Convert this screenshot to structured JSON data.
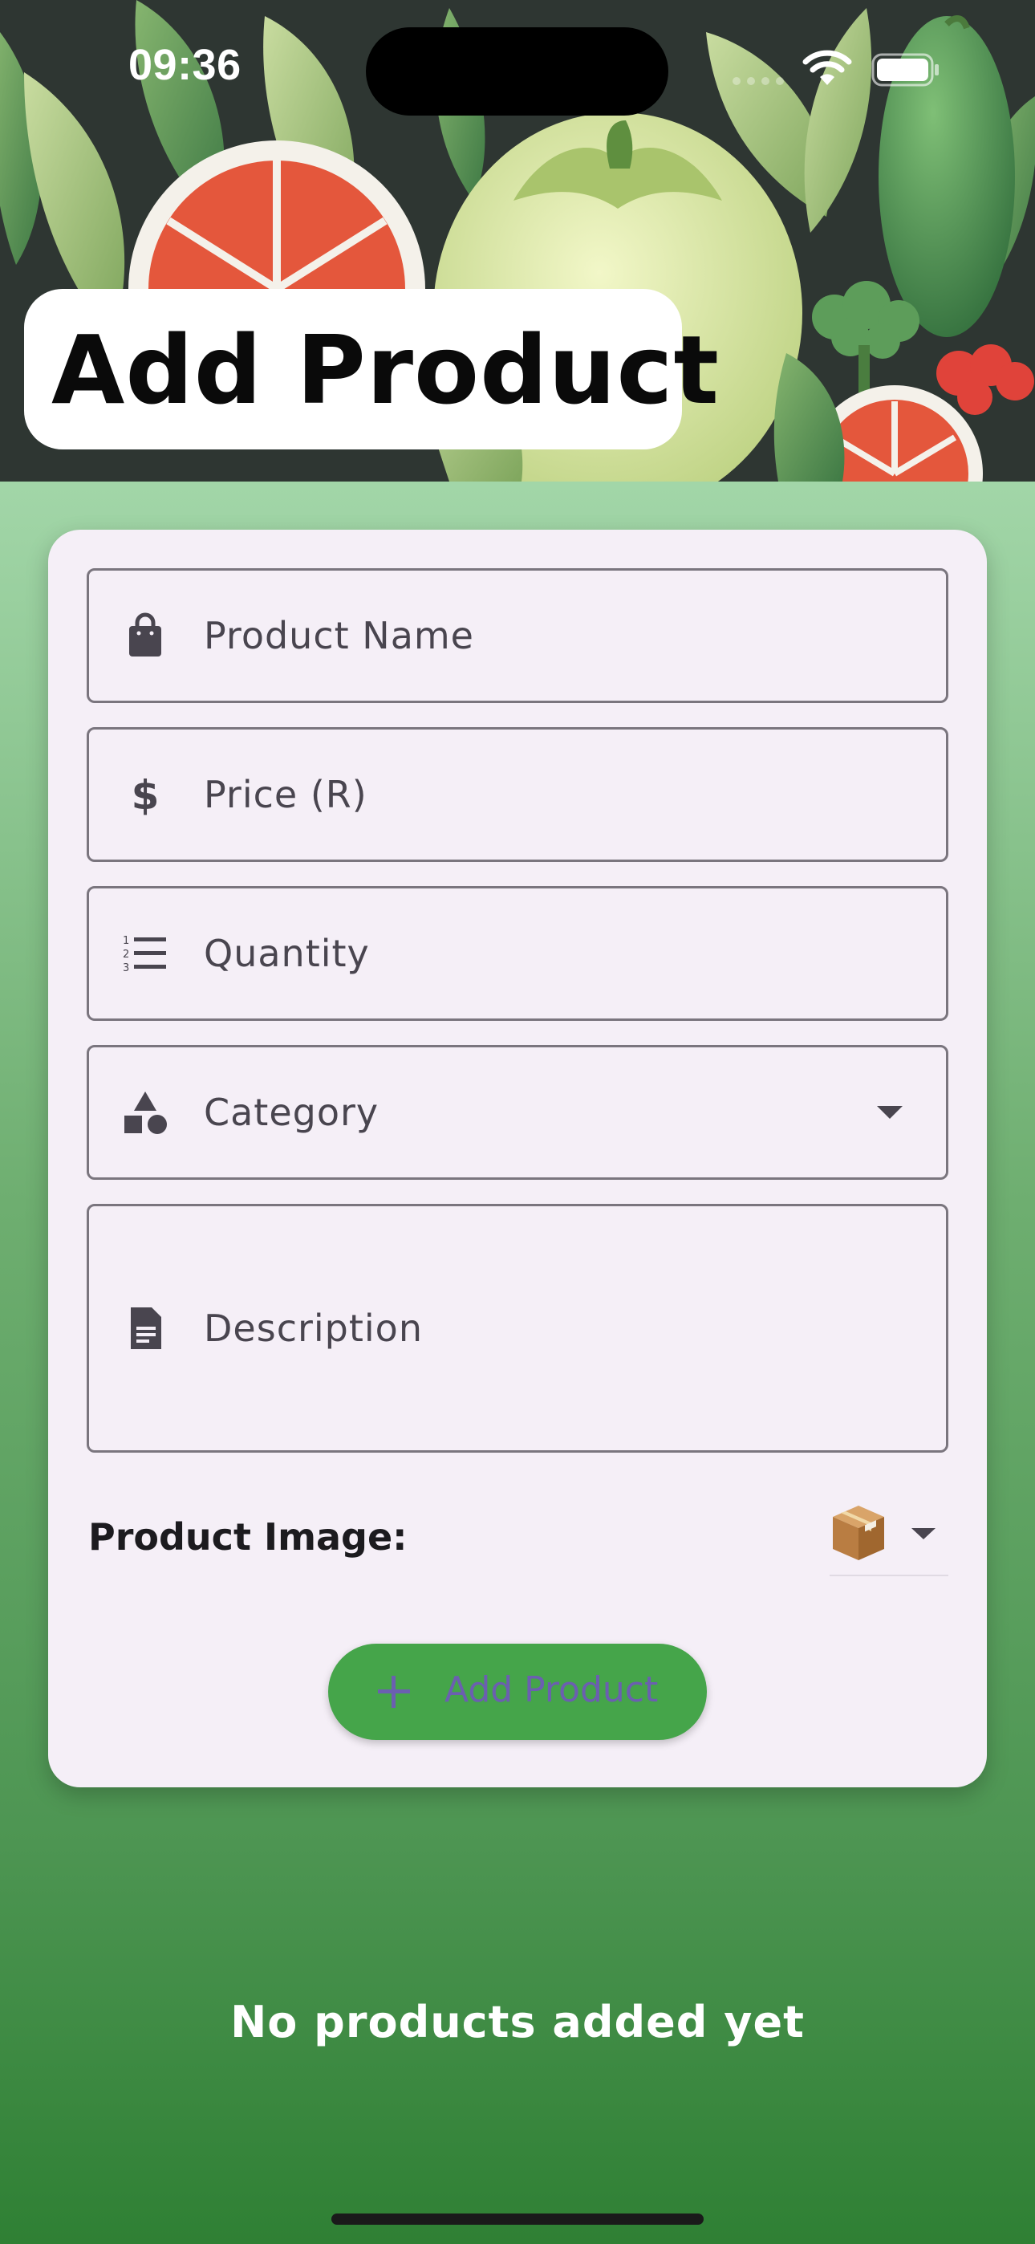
{
  "status_bar": {
    "time": "09:36",
    "icons": [
      "signal-icon",
      "wifi-icon",
      "battery-icon"
    ]
  },
  "header": {
    "title": "Add Product",
    "background_image": "vegetables-illustration"
  },
  "form": {
    "fields": [
      {
        "label": "Product Name",
        "icon": "shopping-bag-icon",
        "value": ""
      },
      {
        "label": "Price (R)",
        "icon": "dollar-icon",
        "value": ""
      },
      {
        "label": "Quantity",
        "icon": "numbered-list-icon",
        "value": ""
      },
      {
        "label": "Category",
        "icon": "category-shapes-icon",
        "value": "",
        "type": "dropdown"
      },
      {
        "label": "Description",
        "icon": "document-icon",
        "value": ""
      }
    ],
    "image_picker": {
      "label": "Product Image:",
      "selected_icon": "package-box-icon"
    },
    "submit_button": {
      "label": "Add Product",
      "icon": "plus-icon"
    }
  },
  "product_list": {
    "empty_message": "No products added yet"
  },
  "colors": {
    "card_background": "#f5eff7",
    "field_border": "#7a757e",
    "button_background": "#45a54a",
    "button_text": "#6b5fb0",
    "page_gradient_top": "#a2d6a8",
    "page_gradient_bottom": "#2f8034"
  }
}
